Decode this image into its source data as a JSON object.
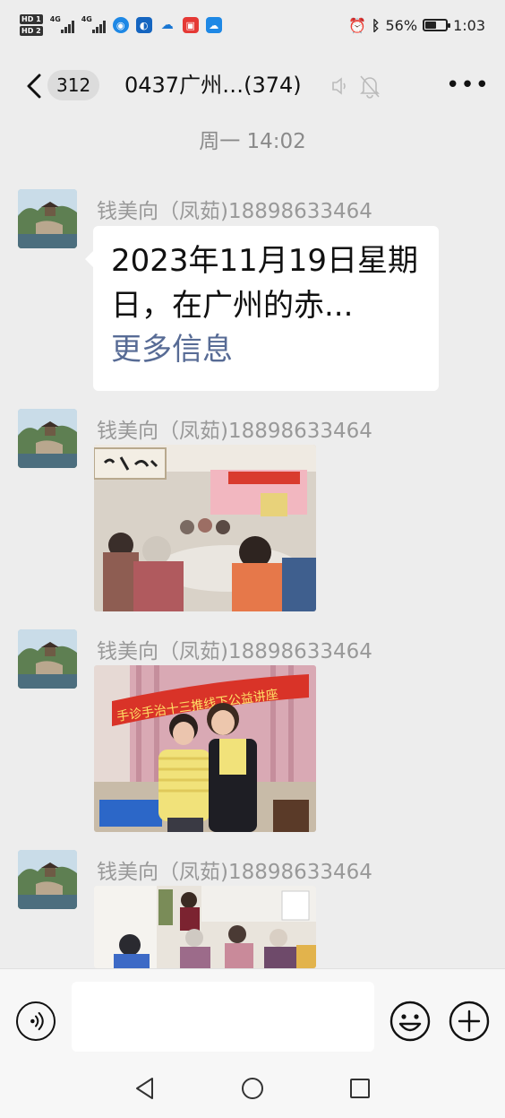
{
  "status_bar": {
    "hd1": "HD 1",
    "hd2": "HD 2",
    "net1": "4G",
    "net2": "4G",
    "battery_percent": "56%",
    "battery_level": 0.56,
    "time": "1:03",
    "icons": [
      "browser-icon",
      "security-icon",
      "cloud-icon",
      "books-icon",
      "weather-icon",
      "alarm-icon",
      "bluetooth-icon"
    ]
  },
  "header": {
    "unread_count": "312",
    "title": "0437广州…(374)",
    "icons": [
      "back-icon",
      "earpiece-icon",
      "mute-bell-icon",
      "more-icon"
    ]
  },
  "time_divider": "周一 14:02",
  "messages": [
    {
      "sender": "钱美向（凤茹)18898633464",
      "type": "text",
      "text": "2023年11月19日星期日，在广州的赤...",
      "more_label": "更多信息"
    },
    {
      "sender": "钱美向（凤茹)18898633464",
      "type": "image",
      "image_desc_icon": "photo-icon"
    },
    {
      "sender": "钱美向（凤茹)18898633464",
      "type": "image",
      "banner_text": "手诊手治十三推线下公益讲座"
    },
    {
      "sender": "钱美向（凤茹)18898633464",
      "type": "image",
      "image_desc_icon": "photo-icon"
    }
  ],
  "input_bar": {
    "placeholder": "",
    "icons": [
      "voice-icon",
      "emoji-icon",
      "plus-icon"
    ]
  },
  "system_nav": {
    "icons": [
      "nav-back-icon",
      "nav-home-icon",
      "nav-recents-icon"
    ]
  },
  "colors": {
    "background": "#EDEDED",
    "link": "#576B95",
    "bubble": "#FFFFFF"
  }
}
